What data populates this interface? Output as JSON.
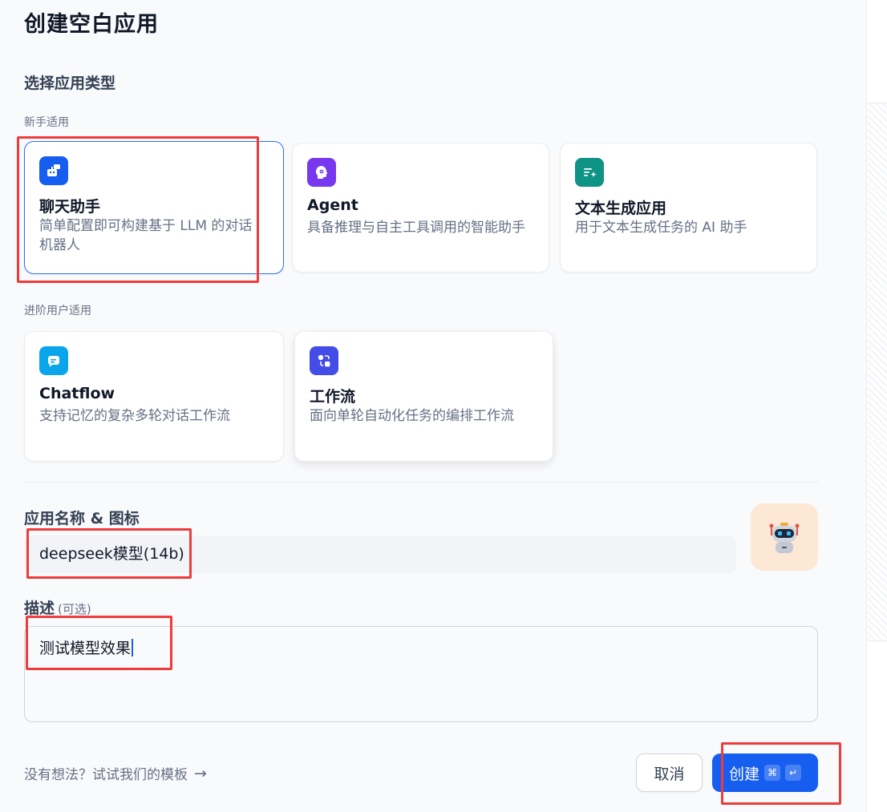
{
  "dialog": {
    "title": "创建空白应用",
    "section_title": "选择应用类型"
  },
  "groups": {
    "beginner_label": "新手适用",
    "advanced_label": "进阶用户适用"
  },
  "app_types": [
    {
      "name": "聊天助手",
      "desc": "简单配置即可构建基于 LLM 的对话机器人",
      "icon": "robot-chat-icon",
      "color": "#155eef",
      "selected": true
    },
    {
      "name": "Agent",
      "desc": "具备推理与自主工具调用的智能助手",
      "icon": "agent-brain-icon",
      "color": "#7839ee",
      "selected": false
    },
    {
      "name": "文本生成应用",
      "desc": "用于文本生成任务的 AI 助手",
      "icon": "text-generate-icon",
      "color": "#0e9384",
      "selected": false
    },
    {
      "name": "Chatflow",
      "desc": "支持记忆的复杂多轮对话工作流",
      "icon": "chatflow-icon",
      "color": "#0ba5ec",
      "selected": false
    },
    {
      "name": "工作流",
      "desc": "面向单轮自动化任务的编排工作流",
      "icon": "workflow-icon",
      "color": "#444ce7",
      "selected": false
    }
  ],
  "form": {
    "name_label": "应用名称 & 图标",
    "name_value": "deepseek模型(14b)",
    "desc_label": "描述",
    "desc_optional": "(可选)",
    "desc_value": "测试模型效果",
    "avatar_icon": "robot-avatar-icon"
  },
  "footer": {
    "template_link": "没有想法？试试我们的模板",
    "cancel_label": "取消",
    "create_label": "创建",
    "create_shortcut_1": "⌘",
    "create_shortcut_2": "↵"
  },
  "colors": {
    "primary": "#155eef",
    "annotation": "#ef3b3b"
  }
}
